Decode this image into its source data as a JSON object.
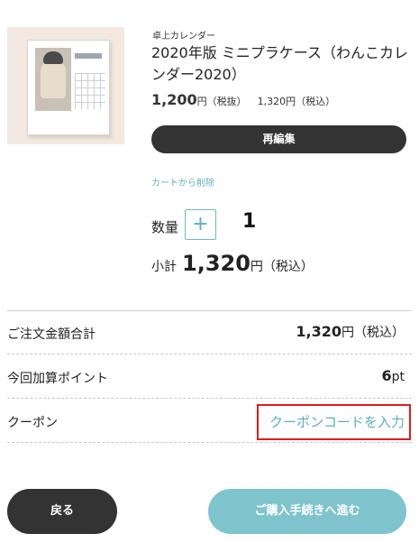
{
  "product": {
    "category": "卓上カレンダー",
    "name": "2020年版 ミニプラケース（わんこカレンダー2020）",
    "price_value": "1,200",
    "price_unit": "円（税抜）",
    "price_tax_included": "1,320円（税込）",
    "image_icon": "calendar-product-photo"
  },
  "actions": {
    "reedit_label": "再編集",
    "remove_label": "カートから削除"
  },
  "quantity": {
    "label": "数量",
    "plus_symbol": "+",
    "value": "1"
  },
  "subtotal": {
    "label": "小計",
    "amount": "1,320",
    "unit": "円（税込）"
  },
  "summary": {
    "order_total_label": "ご注文金額合計",
    "order_total_value": "1,320",
    "order_total_unit": "円（税込）",
    "points_label": "今回加算ポイント",
    "points_value": "6",
    "points_unit": "pt",
    "coupon_label": "クーポン",
    "coupon_link": "クーポンコードを入力"
  },
  "footer": {
    "back_label": "戻る",
    "proceed_label": "ご購入手続きへ進む"
  },
  "colors": {
    "accent": "#5bb0bc",
    "dark_button": "#333333",
    "proceed_button": "#7fc4cc",
    "highlight_border": "#e11b1b"
  }
}
